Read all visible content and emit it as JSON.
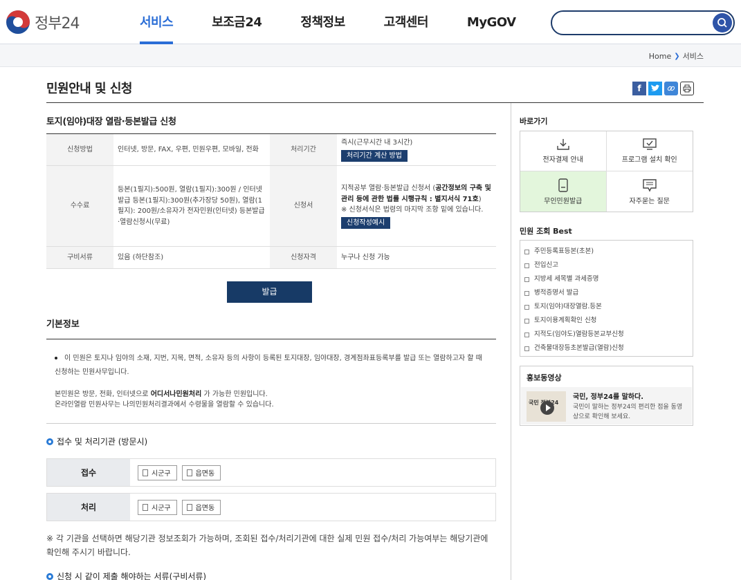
{
  "header": {
    "logo_text": "정부24",
    "nav": [
      "서비스",
      "보조금24",
      "정책정보",
      "고객센터",
      "MyGOV"
    ],
    "active_nav": "서비스",
    "search": {
      "value": "",
      "placeholder": ""
    }
  },
  "breadcrumb": {
    "home": "Home",
    "current": "서비스"
  },
  "page": {
    "title": "민원안내 및 신청"
  },
  "service": {
    "title": "토지(임야)대장 열람·등본발급 신청",
    "table": {
      "method_label": "신청방법",
      "method_value": "인터넷, 방문, FAX, 우편, 민원우편, 모바일, 전화",
      "period_label": "처리기간",
      "period_value": "즉시(근무시간 내 3시간)",
      "period_button": "처리기간 계산 방법",
      "fee_label": "수수료",
      "fee_value": "등본(1필지):500원, 열람(1필지):300원 / 인터넷발급 등본(1필지):300원(추가장당 50원), 열람(1필지): 200원/소유자가 전자민원(인터넷) 등본발급·열람신청시(무료)",
      "form_label": "신청서",
      "form_value_plain": "지적공부 열람·등본발급 신청서 (",
      "form_value_bold": "공간정보의 구축 및 관리 등에 관한 법률 시행규칙 : 별지서식 71호",
      "form_value_close": ")",
      "form_note": "※ 신청서식은 법령의 마지막 조항 밑에 있습니다.",
      "form_button": "신청작성예시",
      "docs_label": "구비서류",
      "docs_value": "있음 (하단참조)",
      "qual_label": "신청자격",
      "qual_value": "누구나 신청 가능"
    },
    "issue_button": "발급"
  },
  "basic": {
    "title": "기본정보",
    "bullet": "이 민원은 토지나 임야의 소재, 지번, 지목, 면적, 소유자 등의 사항이 등록된 토지대장, 임야대장, 경계점좌표등록부를 발급 또는 열람하고자 할 때 신청하는 민원사무입니다.",
    "para1_pre": "본민원은 방문, 전화, 인터넷으로 ",
    "para1_bold": "어디서나민원처리",
    "para1_post": " 가 가능한 민원입니다.",
    "para2": "온라인열람 민원사무는 나의민원처리결과에서 수령물을 열람할 수 있습니다."
  },
  "agency": {
    "title": "접수 및 처리기관 (방문시)",
    "rows": [
      {
        "label": "접수",
        "buttons": [
          "시군구",
          "읍면동"
        ]
      },
      {
        "label": "처리",
        "buttons": [
          "시군구",
          "읍면동"
        ]
      }
    ],
    "notice": "※ 각 기관을 선택하면 해당기관 정보조회가 가능하며, 조회된 접수/처리기관에 대한 실제 민원 접수/처리 가능여부는 해당기관에 확인해 주시기 바랍니다."
  },
  "required_docs": {
    "title": "신청 시 같이 제출 해야하는 서류(구비서류)"
  },
  "sidebar": {
    "quick_title": "바로가기",
    "quick": [
      {
        "label": "전자결제 안내",
        "icon": "download-icon"
      },
      {
        "label": "프로그램 설치 확인",
        "icon": "monitor-icon"
      },
      {
        "label": "무인민원발급",
        "icon": "kiosk-icon"
      },
      {
        "label": "자주묻는 질문",
        "icon": "faq-icon"
      }
    ],
    "best_title": "민원 조회 Best",
    "best": [
      "주민등록표등본(초본)",
      "전입신고",
      "지방세 세목별 과세증명",
      "병적증명서 발급",
      "토지(임야)대장열람.등본",
      "토지이용계획확인 신청",
      "지적도(임야도)열람등본교부신청",
      "건축물대장등초본발급(열람)신청"
    ],
    "promo_title": "홍보동영상",
    "promo_thumb_text": "국민\n정부24",
    "promo_headline": "국민, 정부24를 말하다.",
    "promo_desc": "국민이 말하는 정부24의 편리한 점을 동영상으로 확인해 보세요."
  },
  "colors": {
    "accent": "#2a6dd6",
    "navy": "#173a66",
    "highlight": "#e3f6dc"
  }
}
